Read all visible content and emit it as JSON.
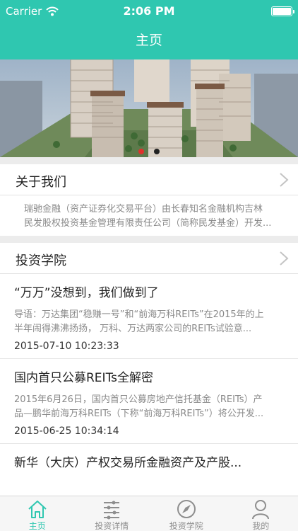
{
  "status_bar": {
    "carrier": "Carrier",
    "time": "2:06 PM"
  },
  "nav": {
    "title": "主页"
  },
  "banner": {
    "image": "residential-buildings-rendering",
    "dot_count": 2,
    "active_dot": 0
  },
  "about": {
    "title": "关于我们",
    "text_line1": "瑞驰金融（资产证券化交易平台）由长春知名金融机构吉林",
    "text_line2": "民发股权投资基金管理有限责任公司（简称民发基金）开发..."
  },
  "academy": {
    "title": "投资学院",
    "articles": [
      {
        "title": "“万万”没想到，我们做到了",
        "summary_line1": "导语：万达集团“稳赚一号”和“前海万科REITs”在2015年的上",
        "summary_line2": "半年闹得沸沸扬扬，  万科、万达两家公司的REITs试验意...",
        "date": "2015-07-10 10:23:33"
      },
      {
        "title": "国内首只公募REITs全解密",
        "summary_line1": "2015年6月26日，国内首只公募房地产信托基金（REITs）产",
        "summary_line2": "品—鹏华前海万科REITs（下称“前海万科REITs”）将公开发...",
        "date": "2015-06-25 10:34:14"
      },
      {
        "title": "新华（大庆）产权交易所金融资产及产股..."
      }
    ]
  },
  "tabs": [
    {
      "label": "主页",
      "icon": "home-icon",
      "active": true
    },
    {
      "label": "投资详情",
      "icon": "list-icon",
      "active": false
    },
    {
      "label": "投资学院",
      "icon": "compass-icon",
      "active": false
    },
    {
      "label": "我的",
      "icon": "person-icon",
      "active": false
    }
  ],
  "colors": {
    "accent": "#2fc7b0",
    "active_dot": "#e0322c"
  }
}
